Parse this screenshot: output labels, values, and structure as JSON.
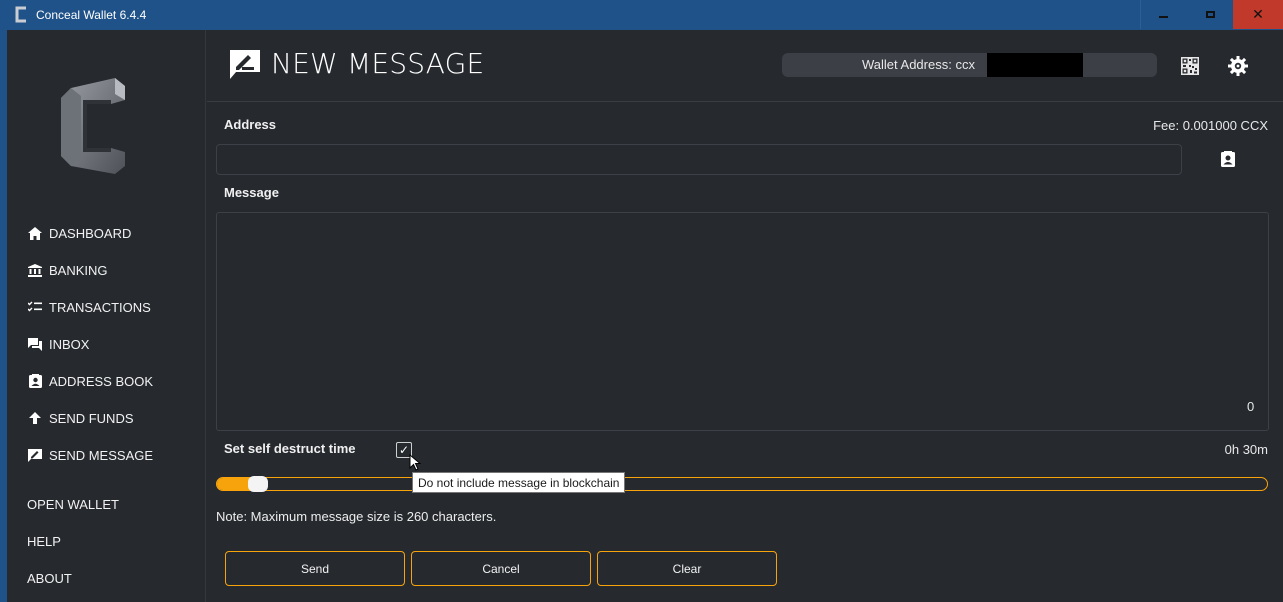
{
  "window": {
    "title": "Conceal Wallet 6.4.4"
  },
  "sidebar": {
    "items": [
      {
        "label": "DASHBOARD",
        "icon": "home-icon"
      },
      {
        "label": "BANKING",
        "icon": "bank-icon"
      },
      {
        "label": "TRANSACTIONS",
        "icon": "checklist-icon"
      },
      {
        "label": "INBOX",
        "icon": "chat-icon"
      },
      {
        "label": "ADDRESS BOOK",
        "icon": "contact-icon"
      },
      {
        "label": "SEND FUNDS",
        "icon": "arrow-up-icon"
      },
      {
        "label": "SEND MESSAGE",
        "icon": "message-edit-icon"
      }
    ],
    "bottom_items": [
      {
        "label": "OPEN WALLET"
      },
      {
        "label": "HELP"
      },
      {
        "label": "ABOUT"
      }
    ]
  },
  "header": {
    "title": "NEW MESSAGE",
    "wallet_address_label": "Wallet Address: ccx"
  },
  "form": {
    "address_label": "Address",
    "fee": "Fee: 0.001000 CCX",
    "address_value": "",
    "message_label": "Message",
    "char_count": "0",
    "destruct_label": "Set self destruct time",
    "destruct_checked": true,
    "destruct_time": "0h 30m",
    "slider_level_percent": 4,
    "tooltip": "Do not include message in blockchain",
    "note": "Note: Maximum message size is 260 characters."
  },
  "buttons": {
    "send": "Send",
    "cancel": "Cancel",
    "clear": "Clear"
  },
  "colors": {
    "accent": "#f7a40c",
    "background": "#262a2f",
    "titlebar": "#1f5288",
    "close": "#c0392b"
  }
}
